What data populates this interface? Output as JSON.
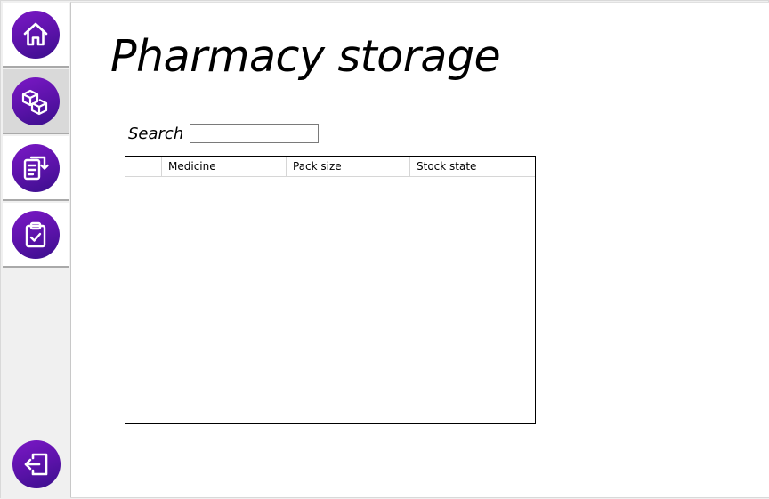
{
  "app": {
    "title": "Pharmacy storage"
  },
  "sidebar": {
    "items": [
      {
        "name": "home",
        "icon": "home-icon",
        "selected": false
      },
      {
        "name": "storage",
        "icon": "boxes-icon",
        "selected": true
      },
      {
        "name": "transfer",
        "icon": "document-transfer-icon",
        "selected": false
      },
      {
        "name": "checklist",
        "icon": "clipboard-check-icon",
        "selected": false
      }
    ],
    "logout_icon": "logout-icon",
    "accent": "#5a12a8"
  },
  "search": {
    "label": "Search",
    "value": ""
  },
  "table": {
    "columns": [
      "Medicine",
      "Pack size",
      "Stock state"
    ],
    "rows": []
  }
}
